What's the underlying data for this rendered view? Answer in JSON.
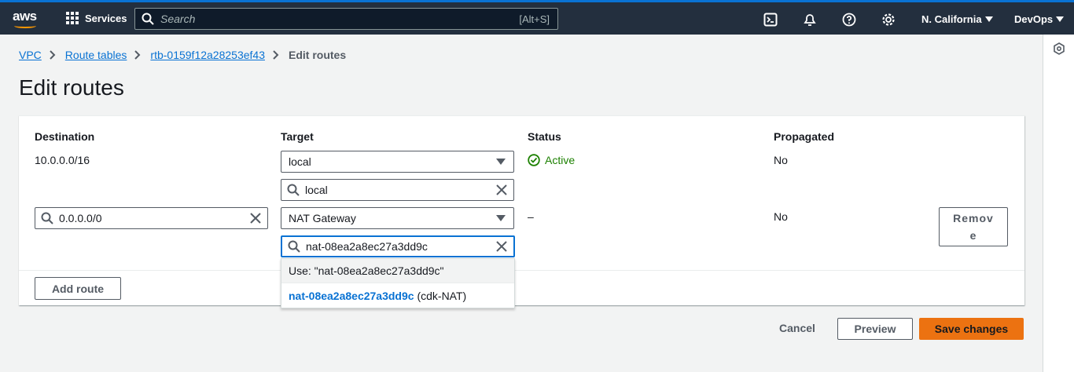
{
  "topbar": {
    "logo_text": "aws",
    "services_label": "Services",
    "search_placeholder": "Search",
    "search_shortcut": "[Alt+S]",
    "region": "N. California",
    "account": "DevOps"
  },
  "breadcrumb": {
    "items": [
      "VPC",
      "Route tables",
      "rtb-0159f12a28253ef43"
    ],
    "current": "Edit routes"
  },
  "page_title": "Edit routes",
  "table": {
    "headers": {
      "destination": "Destination",
      "target": "Target",
      "status": "Status",
      "propagated": "Propagated"
    },
    "rows": [
      {
        "destination": "10.0.0.0/16",
        "target_type": "local",
        "target_filter": "local",
        "status": "Active",
        "propagated": "No"
      },
      {
        "destination": "0.0.0.0/0",
        "target_type": "NAT Gateway",
        "target_filter": "nat-08ea2a8ec27a3dd9c",
        "status": "–",
        "propagated": "No",
        "remove_label_line1": "Remov",
        "remove_label_line2": "e"
      }
    ]
  },
  "dropdown": {
    "use_option": "Use: \"nat-08ea2a8ec27a3dd9c\"",
    "match_id": "nat-08ea2a8ec27a3dd9c",
    "match_name": "(cdk-NAT)"
  },
  "buttons": {
    "add_route": "Add route",
    "cancel": "Cancel",
    "preview": "Preview",
    "save": "Save changes"
  },
  "colors": {
    "nav_bg": "#232f3e",
    "link": "#0972d3",
    "primary": "#ec7211",
    "success": "#1d8102"
  }
}
